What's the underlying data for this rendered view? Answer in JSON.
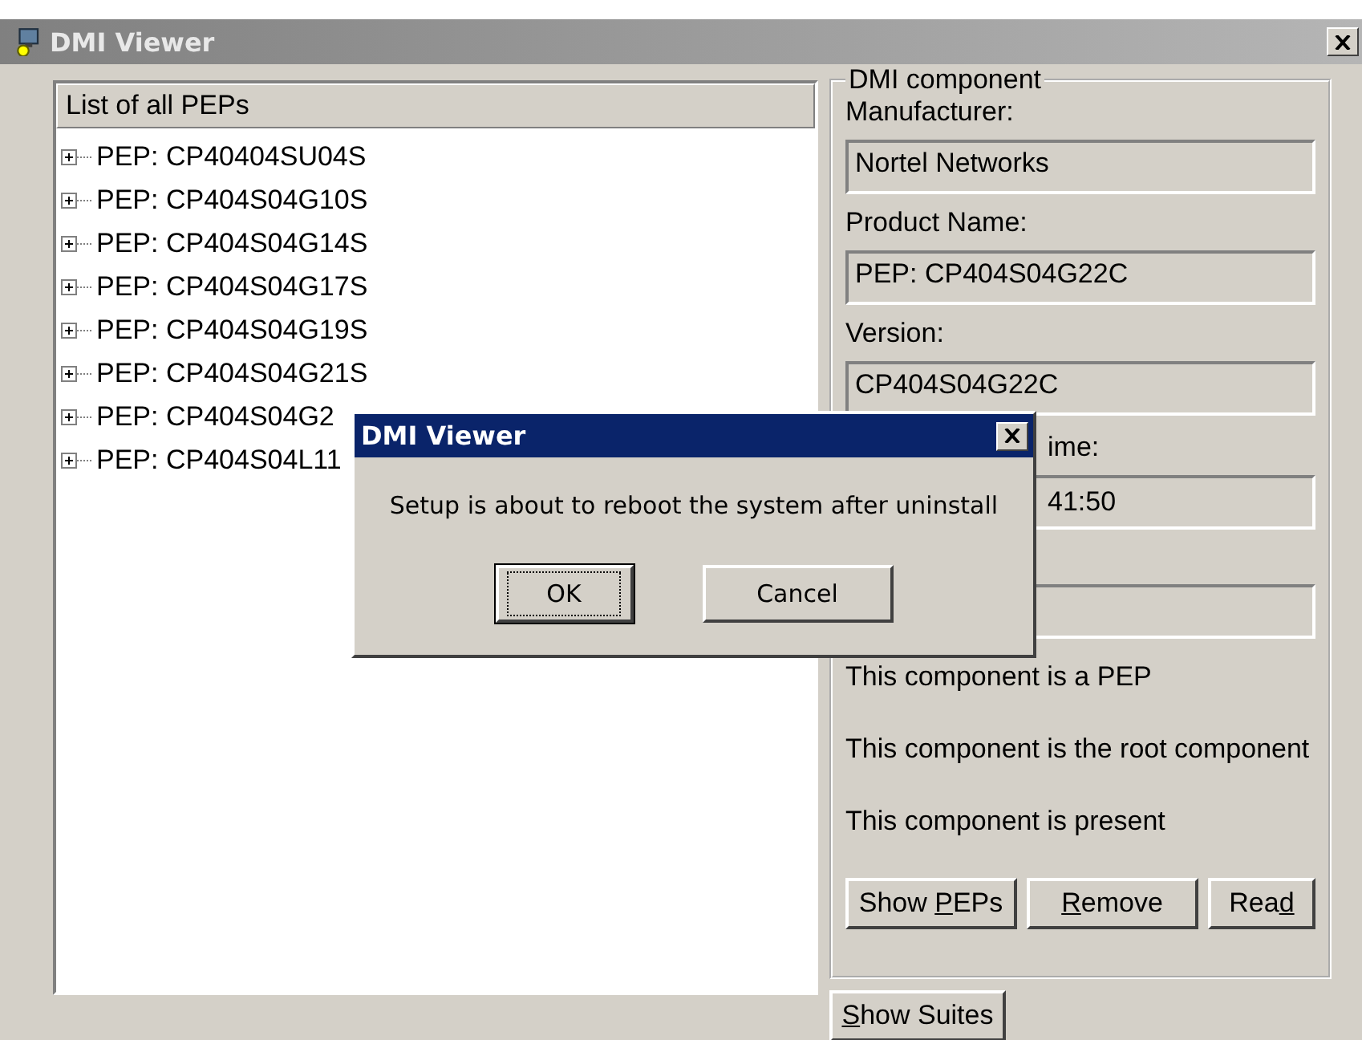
{
  "window": {
    "title": "DMI Viewer"
  },
  "tree": {
    "header": "List of all PEPs",
    "items": [
      {
        "label": "PEP: CP40404SU04S",
        "expanded": false
      },
      {
        "label": "PEP: CP404S04G10S",
        "expanded": false
      },
      {
        "label": "PEP: CP404S04G14S",
        "expanded": false
      },
      {
        "label": "PEP: CP404S04G17S",
        "expanded": false
      },
      {
        "label": "PEP: CP404S04G19S",
        "expanded": false
      },
      {
        "label": "PEP: CP404S04G21S",
        "expanded": false
      },
      {
        "label": "PEP: CP404S04G2",
        "expanded": false
      },
      {
        "label": "PEP: CP404S04L11",
        "expanded": false
      }
    ]
  },
  "component": {
    "title": "DMI component",
    "fields": [
      {
        "label": "Manufacturer:",
        "value": "Nortel Networks",
        "obscured": false
      },
      {
        "label": "Product Name:",
        "value": "PEP: CP404S04G22C",
        "obscured": false
      },
      {
        "label": "Version:",
        "value": "CP404S04G22C",
        "obscured": false
      },
      {
        "label": "ime:",
        "value": "41:50",
        "obscured": true
      }
    ],
    "statements": [
      "This component is a PEP",
      "This component is the root component",
      "This component is present"
    ],
    "buttons": [
      {
        "before": "Show ",
        "key": "P",
        "after": "EPs"
      },
      {
        "key": "R",
        "after": "emove"
      },
      {
        "before": "Rea",
        "key": "d"
      }
    ]
  },
  "bottom_button": {
    "key": "S",
    "after": "how Suites"
  },
  "dialog": {
    "title": "DMI Viewer",
    "message": "Setup is about to reboot the system after uninstall",
    "buttons": [
      {
        "label": "OK",
        "default": true
      },
      {
        "label": "Cancel",
        "default": false
      }
    ]
  }
}
